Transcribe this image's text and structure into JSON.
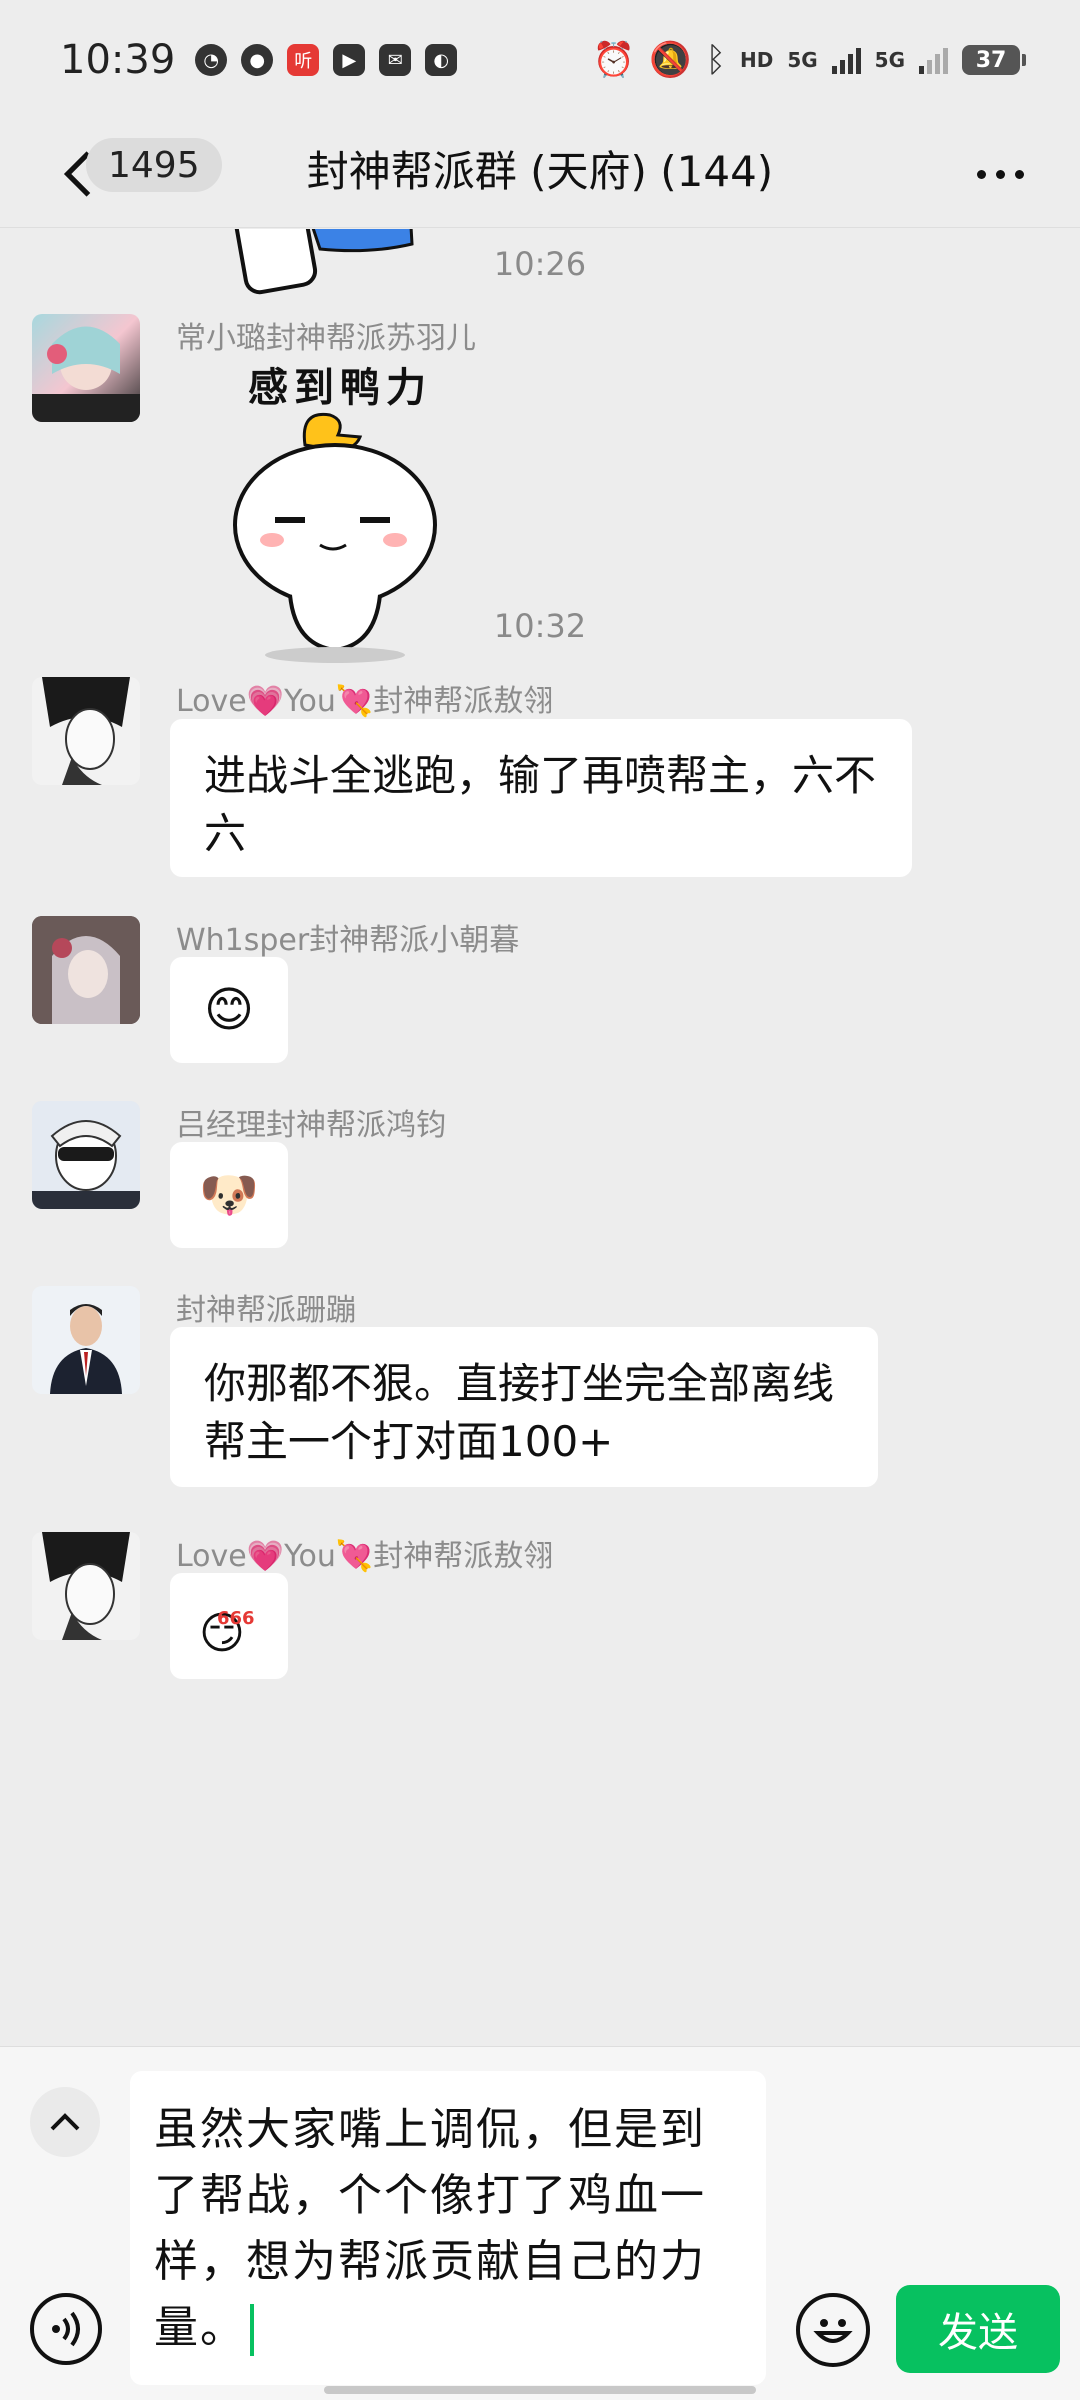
{
  "status_bar": {
    "time": "10:39",
    "app_icons": [
      "qq-icon",
      "wechat-icon",
      "ting-app-icon",
      "video-player-icon",
      "mail-icon",
      "gallery-icon"
    ],
    "network_1": "HD",
    "network_2": "5G",
    "network_3": "5G",
    "battery": "37"
  },
  "header": {
    "unread_count": "1495",
    "title": "封神帮派群 (天府) (144)"
  },
  "chat": {
    "timestamps": [
      "10:26",
      "10:32"
    ],
    "messages": [
      {
        "sender": "常小璐封神帮派苏羽儿",
        "type": "sticker",
        "sticker_text": "感到鸭力"
      },
      {
        "sender_prefix": "Love",
        "sender_mid": "You",
        "sender_suffix": "封神帮派敖翎",
        "text": "进战斗全逃跑，输了再喷帮主，六不六"
      },
      {
        "sender": "Wh1sper封神帮派小朝暮",
        "emoji": "😊"
      },
      {
        "sender": "吕经理封神帮派鸿钧",
        "emoji": "🐶"
      },
      {
        "sender": "封神帮派跚蹦",
        "text": "你那都不狠。直接打坐完全部离线 帮主一个打对面100+"
      },
      {
        "sender_prefix": "Love",
        "sender_mid": "You",
        "sender_suffix": "封神帮派敖翎",
        "emoji": "666"
      }
    ]
  },
  "input": {
    "text": "虽然大家嘴上调侃，但是到了帮战，个个像打了鸡血一样，想为帮派贡献自己的力量。",
    "send_label": "发送"
  },
  "colors": {
    "accent": "#07c160",
    "background": "#ededed",
    "bubble": "#ffffff"
  }
}
